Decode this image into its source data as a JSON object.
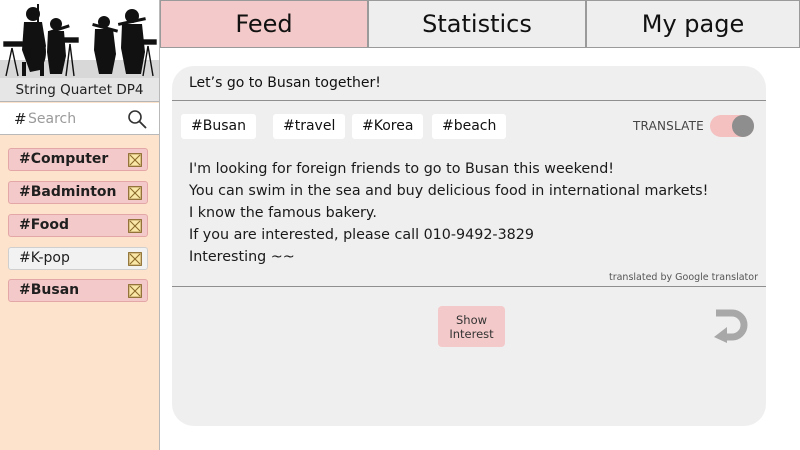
{
  "sidebar": {
    "logo_name": "String Quartet DP4",
    "search": {
      "prefix": "#",
      "placeholder": "Search",
      "value": ""
    },
    "tags": [
      {
        "label": "#Computer",
        "highlighted": true
      },
      {
        "label": "#Badminton",
        "highlighted": true
      },
      {
        "label": "#Food",
        "highlighted": true
      },
      {
        "label": "#K-pop",
        "highlighted": false
      },
      {
        "label": "#Busan",
        "highlighted": true
      }
    ]
  },
  "tabs": [
    {
      "label": "Feed",
      "active": true
    },
    {
      "label": "Statistics",
      "active": false
    },
    {
      "label": "My page",
      "active": false
    }
  ],
  "post": {
    "title": "Let’s go to Busan together!",
    "hashtags": [
      "#Busan",
      "#travel",
      "#Korea",
      "#beach"
    ],
    "translate_label": "TRANSLATE",
    "translate_on": true,
    "body_lines": [
      "I'm looking for foreign friends to go to Busan this weekend!",
      "You can swim in the sea and buy delicious food in international markets!",
      "I know the famous bakery.",
      "If you are interested, please call 010-9492-3829",
      "Interesting ~~"
    ],
    "translated_note": "translated by Google translator",
    "show_interest_label": "Show Interest"
  },
  "colors": {
    "accent_pink": "#f4c9c9",
    "sidebar_bg": "#fde3cc",
    "card_bg": "#efefef",
    "toggle_knob": "#8e8e8e"
  },
  "icons": {
    "search": "search-icon",
    "tag_remove": "x-box-icon",
    "return": "return-arrow-icon"
  }
}
